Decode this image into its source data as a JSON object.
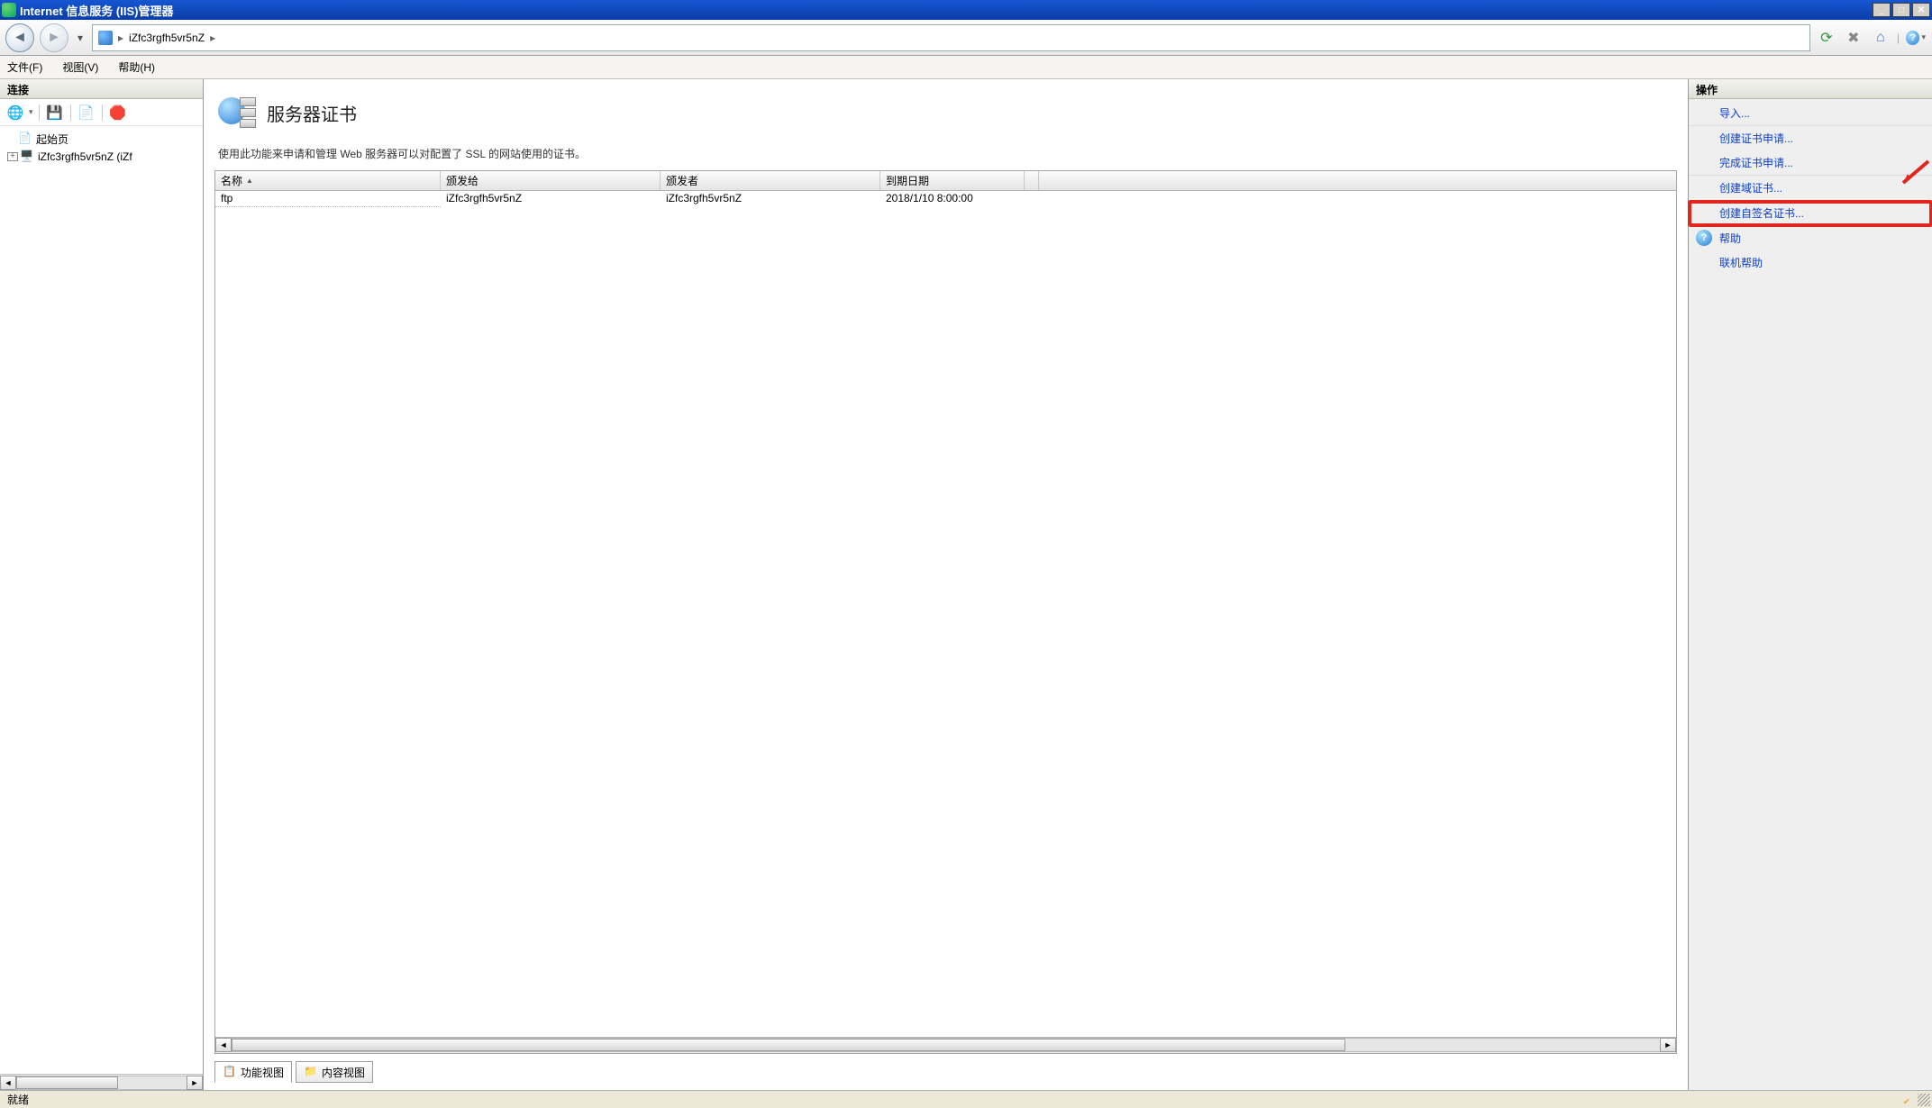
{
  "titlebar": {
    "title": "Internet 信息服务 (IIS)管理器"
  },
  "breadcrumb": {
    "server": "iZfc3rgfh5vr5nZ"
  },
  "menu": {
    "file": "文件(F)",
    "view": "视图(V)",
    "help": "帮助(H)"
  },
  "left_panel": {
    "header": "连接",
    "start_page": "起始页",
    "server_node": "iZfc3rgfh5vr5nZ (iZf"
  },
  "center": {
    "heading": "服务器证书",
    "description": "使用此功能来申请和管理 Web 服务器可以对配置了 SSL 的网站使用的证书。",
    "columns": {
      "name": "名称",
      "issued_to": "颁发给",
      "issued_by": "颁发者",
      "expires": "到期日期"
    },
    "rows": [
      {
        "name": "ftp",
        "issued_to": "iZfc3rgfh5vr5nZ",
        "issued_by": "iZfc3rgfh5vr5nZ",
        "expires": "2018/1/10 8:00:00"
      }
    ],
    "tabs": {
      "feature": "功能视图",
      "content": "内容视图"
    }
  },
  "right_panel": {
    "header": "操作",
    "actions": {
      "import": "导入...",
      "create_request": "创建证书申请...",
      "complete_request": "完成证书申请...",
      "create_domain": "创建域证书...",
      "create_selfsigned": "创建自签名证书...",
      "help": "帮助",
      "online_help": "联机帮助"
    }
  },
  "statusbar": {
    "ready": "就绪"
  }
}
